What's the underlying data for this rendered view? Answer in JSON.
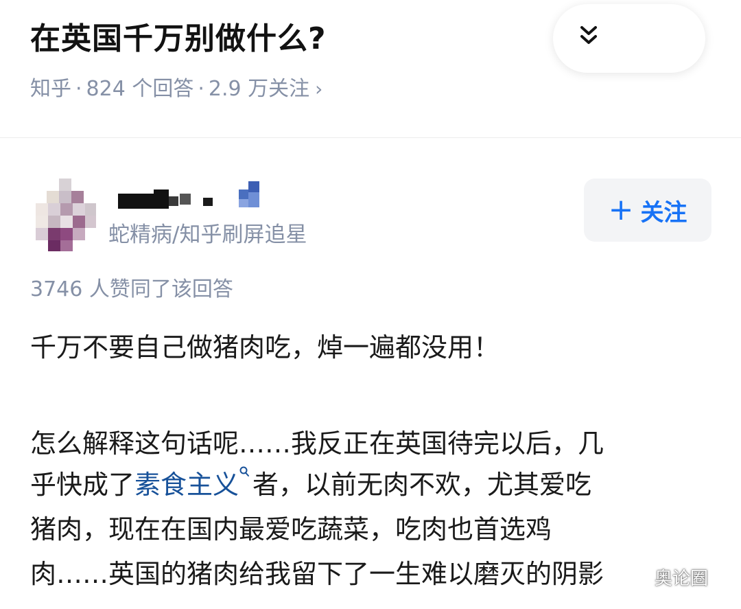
{
  "question": {
    "title": "在英国千万别做什么?",
    "meta": {
      "source": "知乎",
      "answers": "824 个回答",
      "followers": "2.9 万关注",
      "separator": "·",
      "chevron": "›"
    }
  },
  "header_actions": {
    "collapse_icon": "double-chevron-down-icon"
  },
  "author": {
    "headline": "蛇精病/知乎刷屏追星"
  },
  "follow_button": {
    "plus": "+",
    "label": "关注"
  },
  "answer": {
    "vote_count": "3746 人赞同了该回答",
    "lines": [
      "千万不要自己做猪肉吃，焯一遍都没用！",
      "怎么解释这句话呢……我反正在英国待完以后，几",
      "乎快成了",
      "者，以前无肉不欢，尤其爱吃",
      "猪肉，现在在国内最爱吃蔬菜，吃肉也首选鸡",
      "肉……英国的猪肉给我留下了一生难以磨灭的阴影"
    ],
    "link_text": "素食主义",
    "link_icon": "search-link-icon"
  },
  "watermark": {
    "text": "奥论圈",
    "icon": "wechat-icon"
  },
  "colors": {
    "title": "#121212",
    "meta": "#8590a6",
    "accent_blue": "#1772f6",
    "link_blue": "#175199",
    "follow_bg": "#f3f4f6"
  }
}
